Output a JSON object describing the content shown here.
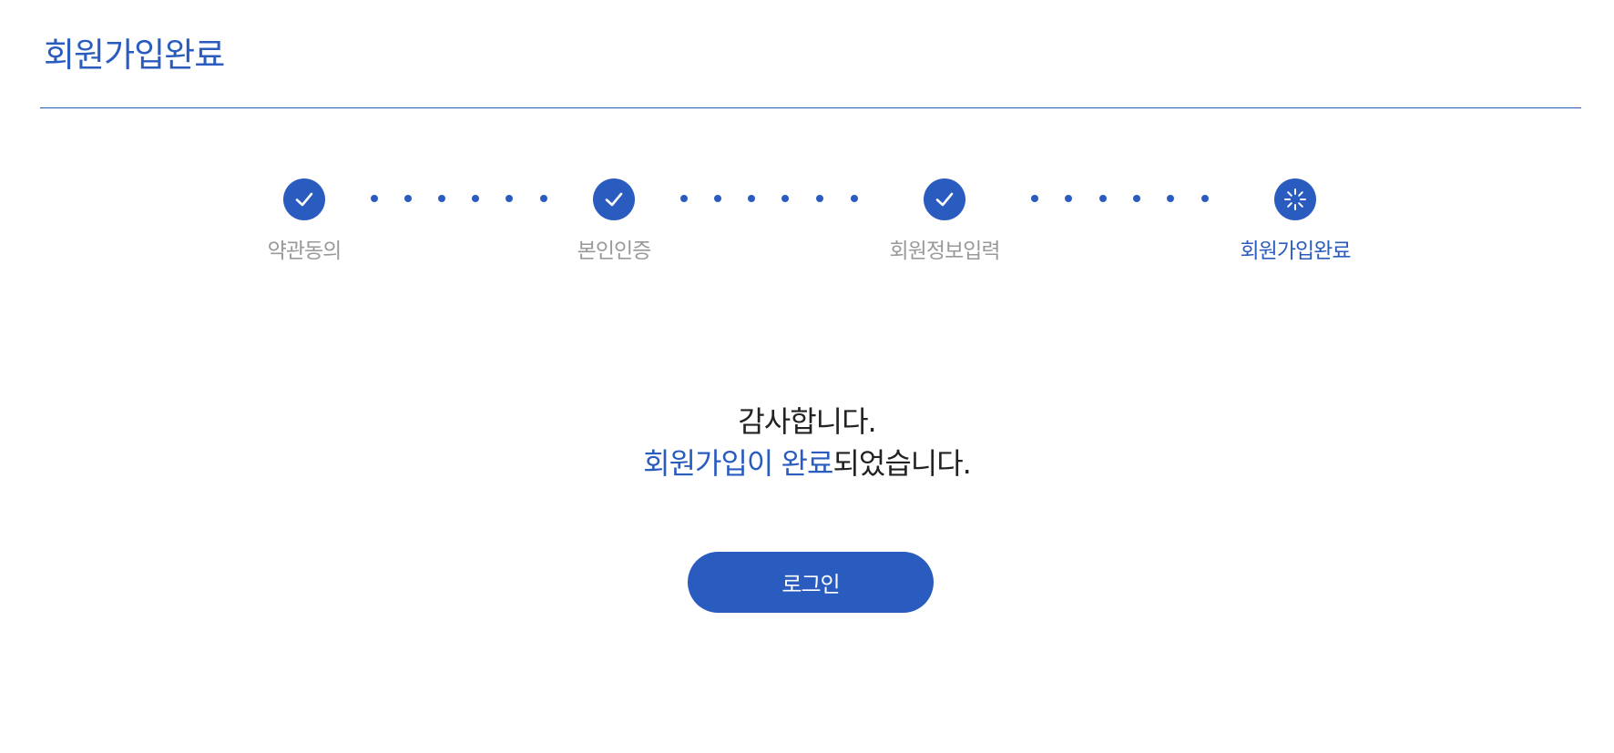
{
  "page": {
    "title": "회원가입완료"
  },
  "steps": [
    {
      "label": "약관동의",
      "status": "done",
      "icon": "check-icon"
    },
    {
      "label": "본인인증",
      "status": "done",
      "icon": "check-icon"
    },
    {
      "label": "회원정보입력",
      "status": "done",
      "icon": "check-icon"
    },
    {
      "label": "회원가입완료",
      "status": "current",
      "icon": "loading-spinner-icon"
    }
  ],
  "message": {
    "line1": "감사합니다.",
    "line2_highlight": "회원가입이 완료",
    "line2_rest": "되었습니다."
  },
  "login_button": {
    "label": "로그인"
  },
  "colors": {
    "accent": "#2a5cbf",
    "step_label_inactive": "#999999",
    "text": "#222222"
  }
}
